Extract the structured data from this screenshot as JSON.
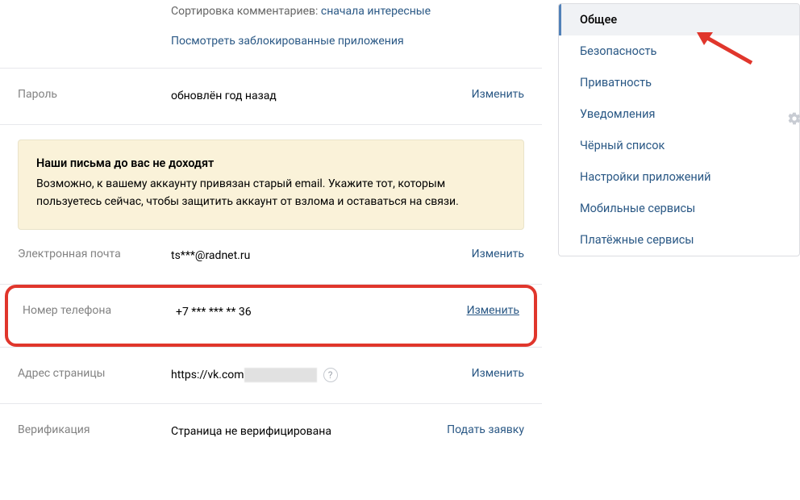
{
  "top": {
    "sort_label": "Сортировка комментариев:",
    "sort_value": "сначала интересные",
    "blocked_apps_link": "Посмотреть заблокированные приложения"
  },
  "password": {
    "label": "Пароль",
    "value": "обновлён год назад",
    "action": "Изменить"
  },
  "warning": {
    "title": "Наши письма до вас не доходят",
    "body": "Возможно, к вашему аккаунту привязан старый email. Укажите тот, которым пользуетесь сейчас, чтобы защитить аккаунт от взлома и оставаться на связи."
  },
  "email": {
    "label": "Электронная почта",
    "value": "ts***@radnet.ru",
    "action": "Изменить"
  },
  "phone": {
    "label": "Номер телефона",
    "value": "+7 *** *** ** 36",
    "action": "Изменить"
  },
  "address": {
    "label": "Адрес страницы",
    "prefix": "https://vk.com",
    "action": "Изменить"
  },
  "verification": {
    "label": "Верификация",
    "value": "Страница не верифицирована",
    "action": "Подать заявку"
  },
  "sidebar": {
    "items": [
      {
        "label": "Общее",
        "active": true
      },
      {
        "label": "Безопасность",
        "active": false
      },
      {
        "label": "Приватность",
        "active": false
      },
      {
        "label": "Уведомления",
        "active": false
      },
      {
        "label": "Чёрный список",
        "active": false
      },
      {
        "label": "Настройки приложений",
        "active": false
      },
      {
        "label": "Мобильные сервисы",
        "active": false
      },
      {
        "label": "Платёжные сервисы",
        "active": false
      }
    ]
  }
}
